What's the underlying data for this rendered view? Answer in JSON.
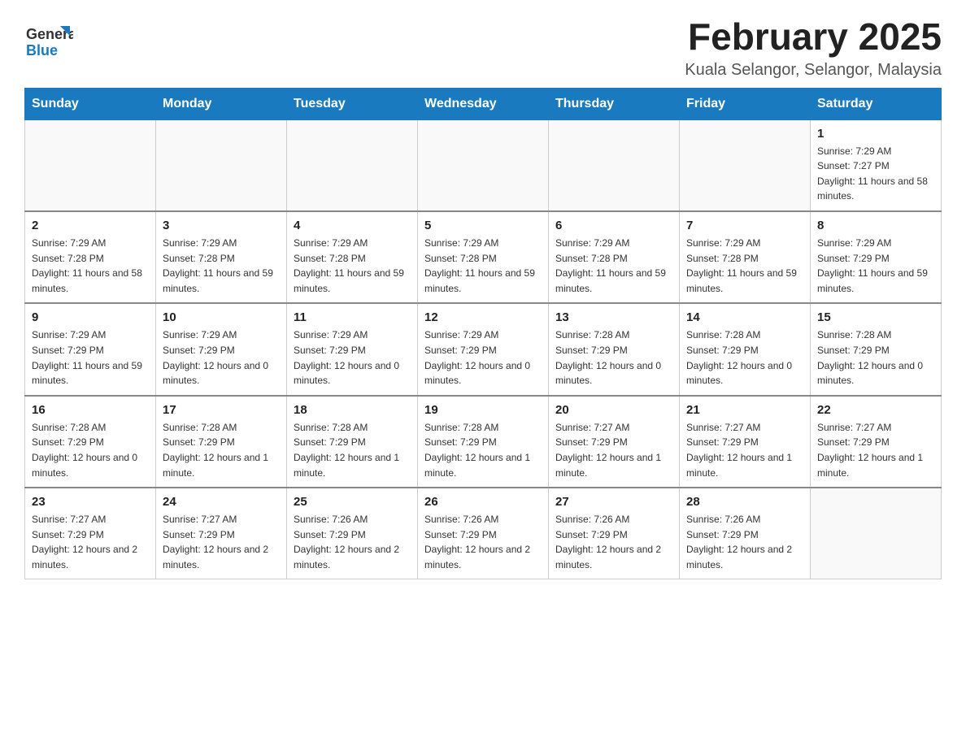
{
  "logo": {
    "text_general": "General",
    "text_blue": "Blue"
  },
  "header": {
    "title": "February 2025",
    "subtitle": "Kuala Selangor, Selangor, Malaysia"
  },
  "days_of_week": [
    "Sunday",
    "Monday",
    "Tuesday",
    "Wednesday",
    "Thursday",
    "Friday",
    "Saturday"
  ],
  "weeks": [
    [
      {
        "day": "",
        "info": ""
      },
      {
        "day": "",
        "info": ""
      },
      {
        "day": "",
        "info": ""
      },
      {
        "day": "",
        "info": ""
      },
      {
        "day": "",
        "info": ""
      },
      {
        "day": "",
        "info": ""
      },
      {
        "day": "1",
        "info": "Sunrise: 7:29 AM\nSunset: 7:27 PM\nDaylight: 11 hours and 58 minutes."
      }
    ],
    [
      {
        "day": "2",
        "info": "Sunrise: 7:29 AM\nSunset: 7:28 PM\nDaylight: 11 hours and 58 minutes."
      },
      {
        "day": "3",
        "info": "Sunrise: 7:29 AM\nSunset: 7:28 PM\nDaylight: 11 hours and 59 minutes."
      },
      {
        "day": "4",
        "info": "Sunrise: 7:29 AM\nSunset: 7:28 PM\nDaylight: 11 hours and 59 minutes."
      },
      {
        "day": "5",
        "info": "Sunrise: 7:29 AM\nSunset: 7:28 PM\nDaylight: 11 hours and 59 minutes."
      },
      {
        "day": "6",
        "info": "Sunrise: 7:29 AM\nSunset: 7:28 PM\nDaylight: 11 hours and 59 minutes."
      },
      {
        "day": "7",
        "info": "Sunrise: 7:29 AM\nSunset: 7:28 PM\nDaylight: 11 hours and 59 minutes."
      },
      {
        "day": "8",
        "info": "Sunrise: 7:29 AM\nSunset: 7:29 PM\nDaylight: 11 hours and 59 minutes."
      }
    ],
    [
      {
        "day": "9",
        "info": "Sunrise: 7:29 AM\nSunset: 7:29 PM\nDaylight: 11 hours and 59 minutes."
      },
      {
        "day": "10",
        "info": "Sunrise: 7:29 AM\nSunset: 7:29 PM\nDaylight: 12 hours and 0 minutes."
      },
      {
        "day": "11",
        "info": "Sunrise: 7:29 AM\nSunset: 7:29 PM\nDaylight: 12 hours and 0 minutes."
      },
      {
        "day": "12",
        "info": "Sunrise: 7:29 AM\nSunset: 7:29 PM\nDaylight: 12 hours and 0 minutes."
      },
      {
        "day": "13",
        "info": "Sunrise: 7:28 AM\nSunset: 7:29 PM\nDaylight: 12 hours and 0 minutes."
      },
      {
        "day": "14",
        "info": "Sunrise: 7:28 AM\nSunset: 7:29 PM\nDaylight: 12 hours and 0 minutes."
      },
      {
        "day": "15",
        "info": "Sunrise: 7:28 AM\nSunset: 7:29 PM\nDaylight: 12 hours and 0 minutes."
      }
    ],
    [
      {
        "day": "16",
        "info": "Sunrise: 7:28 AM\nSunset: 7:29 PM\nDaylight: 12 hours and 0 minutes."
      },
      {
        "day": "17",
        "info": "Sunrise: 7:28 AM\nSunset: 7:29 PM\nDaylight: 12 hours and 1 minute."
      },
      {
        "day": "18",
        "info": "Sunrise: 7:28 AM\nSunset: 7:29 PM\nDaylight: 12 hours and 1 minute."
      },
      {
        "day": "19",
        "info": "Sunrise: 7:28 AM\nSunset: 7:29 PM\nDaylight: 12 hours and 1 minute."
      },
      {
        "day": "20",
        "info": "Sunrise: 7:27 AM\nSunset: 7:29 PM\nDaylight: 12 hours and 1 minute."
      },
      {
        "day": "21",
        "info": "Sunrise: 7:27 AM\nSunset: 7:29 PM\nDaylight: 12 hours and 1 minute."
      },
      {
        "day": "22",
        "info": "Sunrise: 7:27 AM\nSunset: 7:29 PM\nDaylight: 12 hours and 1 minute."
      }
    ],
    [
      {
        "day": "23",
        "info": "Sunrise: 7:27 AM\nSunset: 7:29 PM\nDaylight: 12 hours and 2 minutes."
      },
      {
        "day": "24",
        "info": "Sunrise: 7:27 AM\nSunset: 7:29 PM\nDaylight: 12 hours and 2 minutes."
      },
      {
        "day": "25",
        "info": "Sunrise: 7:26 AM\nSunset: 7:29 PM\nDaylight: 12 hours and 2 minutes."
      },
      {
        "day": "26",
        "info": "Sunrise: 7:26 AM\nSunset: 7:29 PM\nDaylight: 12 hours and 2 minutes."
      },
      {
        "day": "27",
        "info": "Sunrise: 7:26 AM\nSunset: 7:29 PM\nDaylight: 12 hours and 2 minutes."
      },
      {
        "day": "28",
        "info": "Sunrise: 7:26 AM\nSunset: 7:29 PM\nDaylight: 12 hours and 2 minutes."
      },
      {
        "day": "",
        "info": ""
      }
    ]
  ]
}
